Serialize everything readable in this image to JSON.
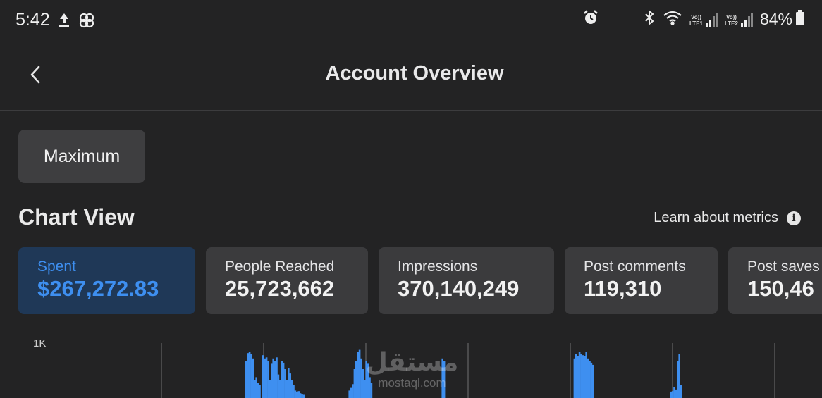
{
  "status_bar": {
    "time": "5:42",
    "battery_text": "84%",
    "left_icons": [
      "upload-icon",
      "pinwheel-icon"
    ],
    "right_icons": [
      "alarm-icon",
      "bluetooth-icon",
      "wifi-icon",
      "signal-sim1-icon",
      "signal-sim2-icon",
      "battery-icon"
    ],
    "sim1_label_top": "Vo))",
    "sim1_label_bottom": "LTE1",
    "sim2_label_top": "Vo))",
    "sim2_label_bottom": "LTE2"
  },
  "header": {
    "title": "Account Overview",
    "back_icon": "chevron-left-icon"
  },
  "date_range": {
    "label": "Maximum"
  },
  "chart_section": {
    "title": "Chart View",
    "learn_link": "Learn about metrics",
    "info_icon": "info-icon"
  },
  "metrics": [
    {
      "label": "Spent",
      "value": "$267,272.83",
      "active": true
    },
    {
      "label": "People Reached",
      "value": "25,723,662",
      "active": false
    },
    {
      "label": "Impressions",
      "value": "370,140,249",
      "active": false
    },
    {
      "label": "Post comments",
      "value": "119,310",
      "active": false
    },
    {
      "label": "Post saves",
      "value": "150,46",
      "active": false
    }
  ],
  "watermark": {
    "arabic": "مستقل",
    "latin": "mostaql.com"
  },
  "colors": {
    "background": "#232324",
    "card": "#3b3b3d",
    "card_active": "#1f3857",
    "accent": "#3e8ff0"
  },
  "chart_data": {
    "type": "bar",
    "ytick_labels": [
      "1K"
    ],
    "ylim": [
      0,
      1000
    ],
    "bar_color": "#3e8ff0",
    "x": [
      120,
      121,
      122,
      123,
      124,
      125,
      126,
      127,
      128,
      130,
      131,
      132,
      133,
      134,
      135,
      136,
      137,
      138,
      139,
      140,
      141,
      142,
      143,
      144,
      145,
      146,
      147,
      148,
      149,
      150,
      151,
      152,
      153,
      154,
      181,
      182,
      183,
      184,
      185,
      186,
      187,
      188,
      189,
      190,
      191,
      192,
      193,
      194,
      236,
      237,
      314,
      315,
      316,
      317,
      318,
      319,
      320,
      321,
      322,
      323,
      324,
      325,
      371,
      372,
      373,
      374,
      375,
      376,
      377
    ],
    "values": [
      650,
      800,
      820,
      780,
      700,
      300,
      350,
      250,
      200,
      760,
      700,
      720,
      650,
      300,
      600,
      700,
      650,
      720,
      400,
      300,
      650,
      620,
      500,
      300,
      520,
      420,
      300,
      200,
      100,
      80,
      90,
      50,
      30,
      20,
      100,
      150,
      220,
      500,
      650,
      820,
      860,
      700,
      500,
      300,
      650,
      600,
      350,
      250,
      700,
      650,
      700,
      790,
      750,
      820,
      780,
      760,
      740,
      820,
      700,
      650,
      620,
      580,
      80,
      90,
      160,
      120,
      650,
      780,
      200
    ]
  }
}
